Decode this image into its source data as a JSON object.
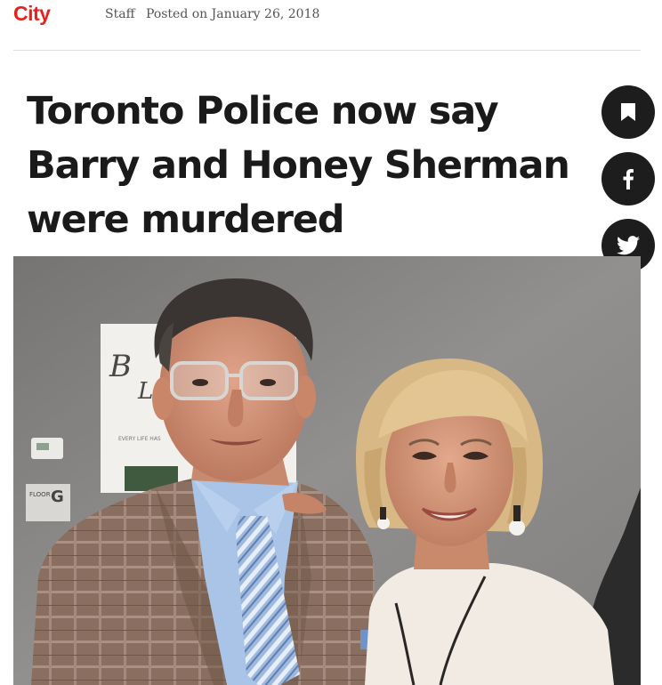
{
  "site": {
    "logo_text": "City",
    "brand_color": "#e8211c"
  },
  "byline": {
    "author": "Staff",
    "posted": "Posted on January 26, 2018"
  },
  "article": {
    "headline": "Toronto Police now say Barry and Honey Sherman were murdered"
  },
  "social": {
    "buttons": [
      {
        "icon": "bookmark-icon"
      },
      {
        "icon": "facebook-icon"
      },
      {
        "icon": "twitter-icon"
      }
    ]
  },
  "photo": {
    "background_text": {
      "poster_subtitle": "EVERY LIFE HAS",
      "floor_label": "FLOOR",
      "floor_letter": "G"
    }
  }
}
